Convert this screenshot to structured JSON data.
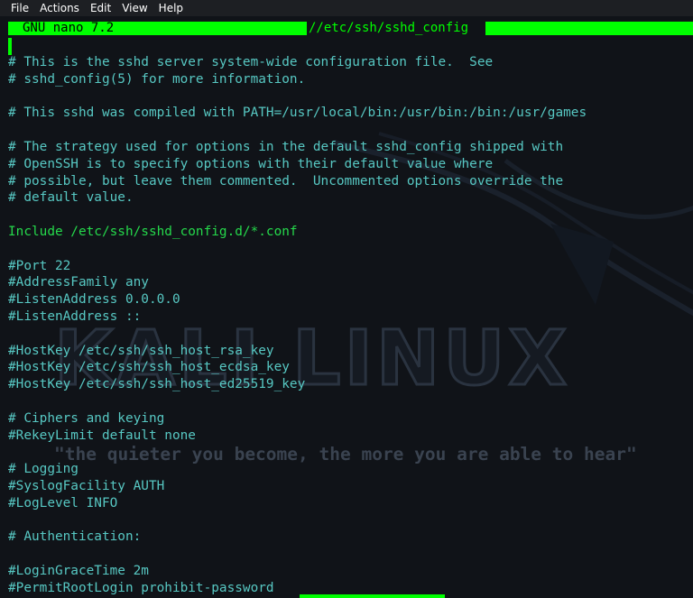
{
  "menubar": {
    "items": [
      {
        "label": "File"
      },
      {
        "label": "Actions"
      },
      {
        "label": "Edit"
      },
      {
        "label": "View"
      },
      {
        "label": "Help"
      }
    ]
  },
  "editor": {
    "app_title": "GNU nano 7.2",
    "filename": "//etc/ssh/sshd_config"
  },
  "watermark": {
    "logo": "KALI LINUX",
    "tagline": "\"the quieter you become, the more you are able to hear\""
  },
  "file_lines": [
    {
      "text": "# This is the sshd server system-wide configuration file.  See",
      "kind": "comment"
    },
    {
      "text": "# sshd_config(5) for more information.",
      "kind": "comment"
    },
    {
      "text": "",
      "kind": "blank"
    },
    {
      "text": "# This sshd was compiled with PATH=/usr/local/bin:/usr/bin:/bin:/usr/games",
      "kind": "comment"
    },
    {
      "text": "",
      "kind": "blank"
    },
    {
      "text": "# The strategy used for options in the default sshd_config shipped with",
      "kind": "comment"
    },
    {
      "text": "# OpenSSH is to specify options with their default value where",
      "kind": "comment"
    },
    {
      "text": "# possible, but leave them commented.  Uncommented options override the",
      "kind": "comment"
    },
    {
      "text": "# default value.",
      "kind": "comment"
    },
    {
      "text": "",
      "kind": "blank"
    },
    {
      "text": "Include /etc/ssh/sshd_config.d/*.conf",
      "kind": "directive"
    },
    {
      "text": "",
      "kind": "blank"
    },
    {
      "text": "#Port 22",
      "kind": "comment"
    },
    {
      "text": "#AddressFamily any",
      "kind": "comment"
    },
    {
      "text": "#ListenAddress 0.0.0.0",
      "kind": "comment"
    },
    {
      "text": "#ListenAddress ::",
      "kind": "comment"
    },
    {
      "text": "",
      "kind": "blank"
    },
    {
      "text": "#HostKey /etc/ssh/ssh_host_rsa_key",
      "kind": "comment"
    },
    {
      "text": "#HostKey /etc/ssh/ssh_host_ecdsa_key",
      "kind": "comment"
    },
    {
      "text": "#HostKey /etc/ssh/ssh_host_ed25519_key",
      "kind": "comment"
    },
    {
      "text": "",
      "kind": "blank"
    },
    {
      "text": "# Ciphers and keying",
      "kind": "comment"
    },
    {
      "text": "#RekeyLimit default none",
      "kind": "comment"
    },
    {
      "text": "",
      "kind": "blank"
    },
    {
      "text": "# Logging",
      "kind": "comment"
    },
    {
      "text": "#SyslogFacility AUTH",
      "kind": "comment"
    },
    {
      "text": "#LogLevel INFO",
      "kind": "comment"
    },
    {
      "text": "",
      "kind": "blank"
    },
    {
      "text": "# Authentication:",
      "kind": "comment"
    },
    {
      "text": "",
      "kind": "blank"
    },
    {
      "text": "#LoginGraceTime 2m",
      "kind": "comment"
    },
    {
      "text": "#PermitRootLogin prohibit-password",
      "kind": "comment"
    }
  ],
  "colors": {
    "accent": "#00ff00",
    "comment": "#57c8c3",
    "directive": "#25d94b",
    "background": "#101318"
  }
}
